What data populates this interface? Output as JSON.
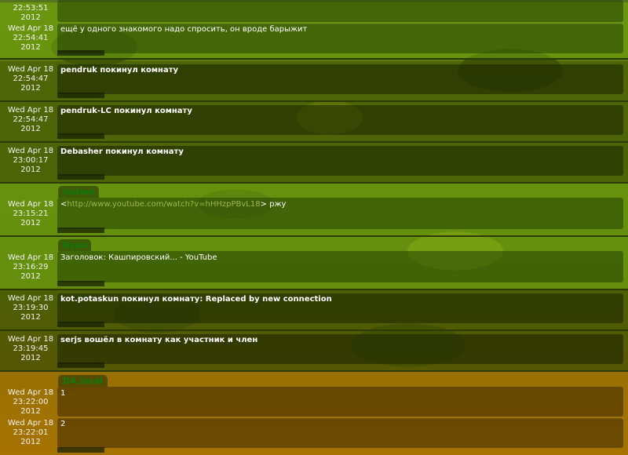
{
  "messages": [
    {
      "ts_day": "Wed Apr 18",
      "ts_time": "22:53:51",
      "ts_year": "2012"
    },
    {
      "ts_day": "Wed Apr 18",
      "ts_time": "22:54:41",
      "ts_year": "2012",
      "text": "ещё у одного знакомого надо спросить, он вроде барыжит"
    },
    {
      "ts_day": "Wed Apr 18",
      "ts_time": "22:54:47",
      "ts_year": "2012",
      "text": "pendruk покинул комнату"
    },
    {
      "ts_day": "Wed Apr 18",
      "ts_time": "22:54:47",
      "ts_year": "2012",
      "text": "pendruk-LC покинул комнату"
    },
    {
      "ts_day": "Wed Apr 18",
      "ts_time": "23:00:17",
      "ts_year": "2012",
      "text": "Debasher покинул комнату"
    },
    {
      "nick": "ivzlom",
      "ts_day": "Wed Apr 18",
      "ts_time": "23:15:21",
      "ts_year": "2012",
      "prefix": "<",
      "link": "http://www.youtube.com/watch?v=hHHzpPBvL18",
      "suffix": "> ржу"
    },
    {
      "nick": "Буэл",
      "ts_day": "Wed Apr 18",
      "ts_time": "23:16:29",
      "ts_year": "2012",
      "text": "Заголовок:  Кашпировский... - YouTube"
    },
    {
      "ts_day": "Wed Apr 18",
      "ts_time": "23:19:30",
      "ts_year": "2012",
      "text": "kot.potaskun покинул комнату: Replaced by new connection"
    },
    {
      "ts_day": "Wed Apr 18",
      "ts_time": "23:19:45",
      "ts_year": "2012",
      "text": "serjs вошёл в комнату как участник и член"
    },
    {
      "nick": "DA.local",
      "ts_day": "Wed Apr 18",
      "ts_time": "23:22:00",
      "ts_year": "2012",
      "text": "1"
    },
    {
      "ts_day": "Wed Apr 18",
      "ts_time": "23:22:01",
      "ts_year": "2012",
      "text": "2"
    }
  ],
  "colors": {
    "nick": "#0e7a0e",
    "link": "#9db84a",
    "system_bg": "#465500",
    "user_bg": "#73aa0f",
    "orange_bg": "#be8200"
  }
}
